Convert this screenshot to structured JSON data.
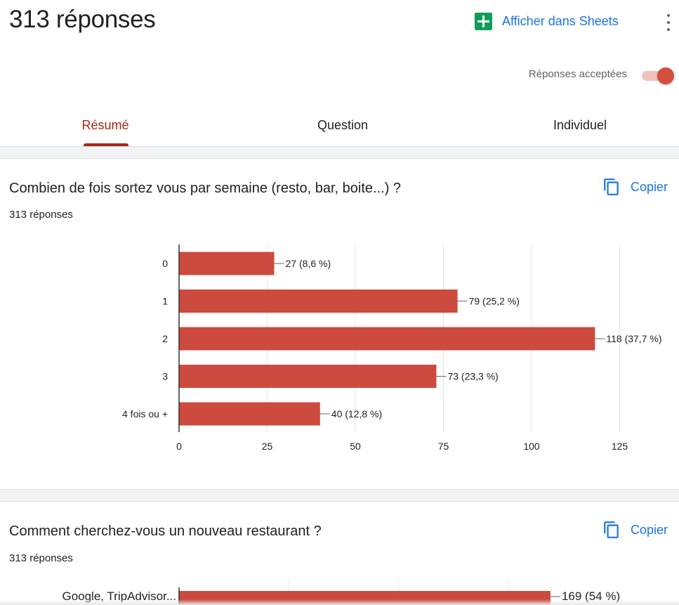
{
  "header": {
    "title": "313 réponses",
    "sheets_label": "Afficher dans Sheets",
    "accepting_label": "Réponses acceptées",
    "accepting_on": true
  },
  "tabs": [
    {
      "label": "Résumé",
      "active": true
    },
    {
      "label": "Question",
      "active": false
    },
    {
      "label": "Individuel",
      "active": false
    }
  ],
  "colors": {
    "accent": "#a52714",
    "bar": "#cc4b3e",
    "link": "#1a73e8",
    "sheets": "#0f9d58"
  },
  "questions": [
    {
      "title": "Combien de fois sortez vous par semaine (resto, bar, boite...) ?",
      "count": "313 réponses",
      "copy_label": "Copier"
    },
    {
      "title": "Comment cherchez-vous un nouveau restaurant ?",
      "count": "313 réponses",
      "copy_label": "Copier"
    }
  ],
  "chart_data": [
    {
      "type": "bar",
      "orientation": "horizontal",
      "categories": [
        "0",
        "1",
        "2",
        "3",
        "4 fois ou +"
      ],
      "values": [
        27,
        79,
        118,
        73,
        40
      ],
      "value_labels": [
        "27 (8,6 %)",
        "79 (25,2 %)",
        "118 (37,7 %)",
        "73 (23,3 %)",
        "40 (12,8 %)"
      ],
      "xticks": [
        "0",
        "25",
        "50",
        "75",
        "100",
        "125"
      ],
      "xlim": [
        0,
        125
      ],
      "grid": true
    },
    {
      "type": "bar",
      "orientation": "horizontal",
      "categories": [
        "Google, TripAdvisor..."
      ],
      "values": [
        169
      ],
      "value_labels": [
        "169 (54 %)"
      ]
    }
  ]
}
